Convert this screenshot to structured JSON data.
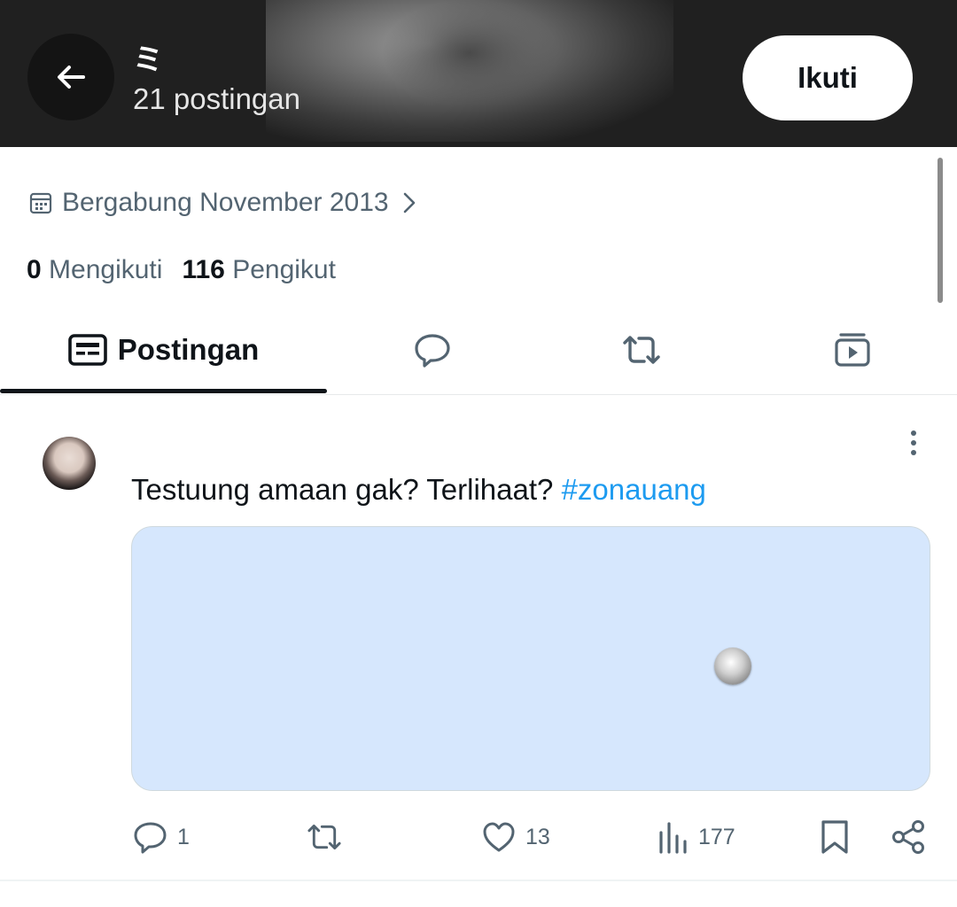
{
  "header": {
    "name": "ミ",
    "post_count": "21 postingan",
    "follow_label": "Ikuti",
    "back_icon": "arrow-left-icon"
  },
  "profile": {
    "joined": "Bergabung November 2013",
    "following_count": "0",
    "following_label": "Mengikuti",
    "followers_count": "116",
    "followers_label": "Pengikut"
  },
  "tabs": [
    {
      "label": "Postingan",
      "icon": "posts-icon",
      "active": true
    },
    {
      "label": "",
      "icon": "reply-bubble-icon",
      "active": false
    },
    {
      "label": "",
      "icon": "repost-icon",
      "active": false
    },
    {
      "label": "",
      "icon": "media-video-icon",
      "active": false
    }
  ],
  "post": {
    "text": "Testuung amaan gak? Terlihaat?",
    "hashtag": "#zonauang",
    "media_color": "#d6e7fd",
    "actions": {
      "replies": "1",
      "reposts": "",
      "likes": "13",
      "views": "177"
    }
  },
  "colors": {
    "accent": "#1d9bf0",
    "muted": "#536471",
    "text": "#0f1419"
  }
}
